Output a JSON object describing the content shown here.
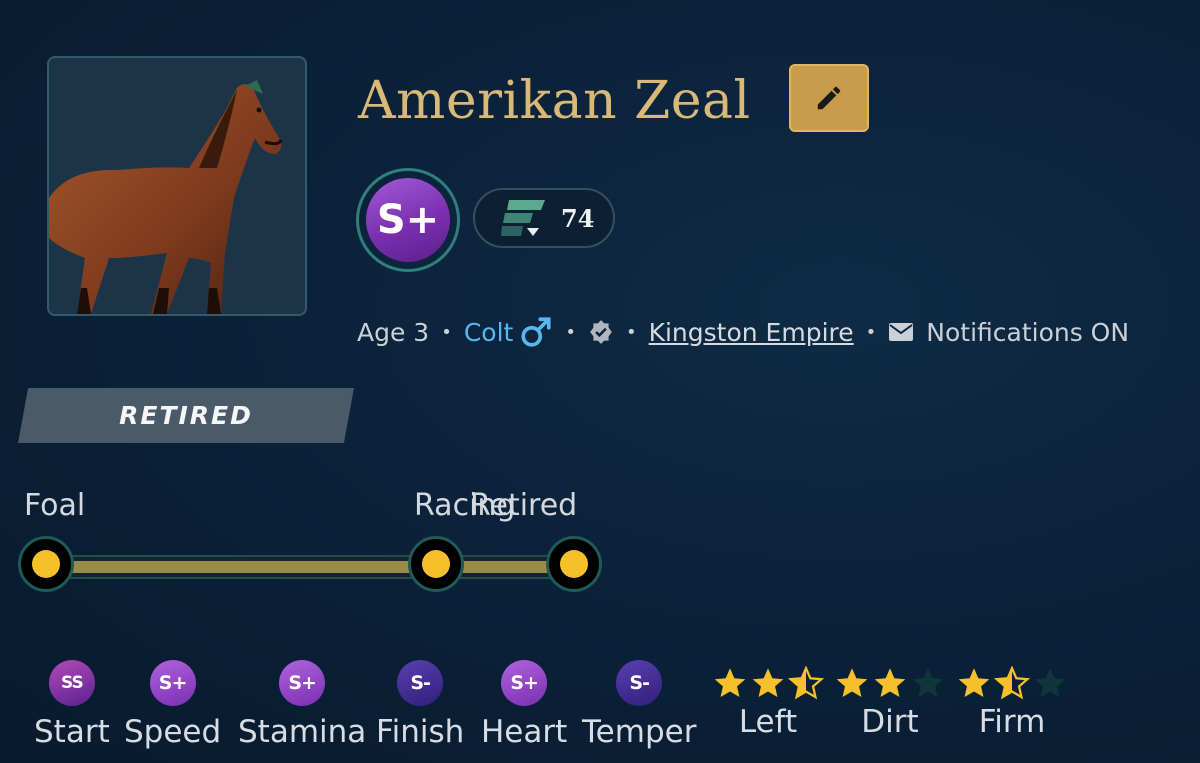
{
  "horse": {
    "name": "Amerikan Zeal",
    "grade": "S+",
    "rating": "74",
    "age": "Age 3",
    "sex": "Colt",
    "stable": "Kingston Empire",
    "notifications": "Notifications ON",
    "status": "RETIRED"
  },
  "timeline": {
    "stages": [
      "Foal",
      "Racing",
      "Retired"
    ],
    "progress": 1.0
  },
  "stats": [
    {
      "grade": "SS",
      "label": "Start"
    },
    {
      "grade": "S+",
      "label": "Speed"
    },
    {
      "grade": "S+",
      "label": "Stamina"
    },
    {
      "grade": "S-",
      "label": "Finish"
    },
    {
      "grade": "S+",
      "label": "Heart"
    },
    {
      "grade": "S-",
      "label": "Temper"
    }
  ],
  "preferences": [
    {
      "label": "Left",
      "stars": 2.5
    },
    {
      "label": "Dirt",
      "stars": 2
    },
    {
      "label": "Firm",
      "stars": 1.5
    }
  ],
  "icons": {
    "edit": "pencil-icon",
    "male": "male-symbol-icon",
    "verified": "verified-badge-icon",
    "mail": "envelope-icon",
    "rating": "rating-chevron-icon"
  },
  "colors": {
    "accent": "#c99b4c",
    "name": "#d9b878",
    "colt": "#59b7ef",
    "star": "#f5c02a",
    "grade": "#7b2fb0"
  }
}
